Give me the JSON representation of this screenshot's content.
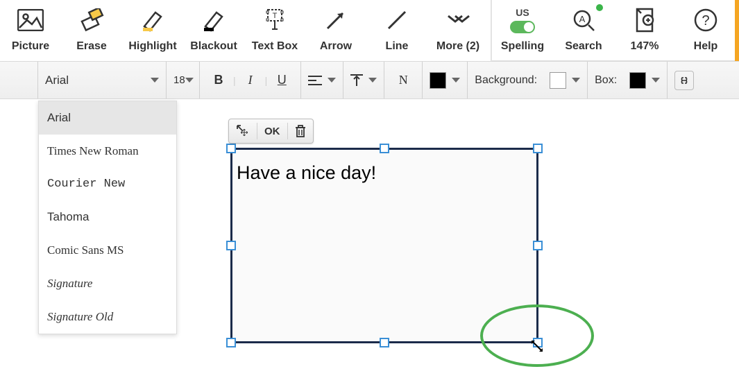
{
  "toolbar": {
    "picture": "Picture",
    "erase": "Erase",
    "highlight": "Highlight",
    "blackout": "Blackout",
    "textbox": "Text Box",
    "arrow": "Arrow",
    "line": "Line",
    "more": "More (2)",
    "spelling_lang": "US",
    "spelling": "Spelling",
    "search": "Search",
    "zoom": "147%",
    "help": "Help"
  },
  "format": {
    "font": "Arial",
    "size": "18",
    "bold": "B",
    "italic": "I",
    "underline": "U",
    "normal": "N",
    "background_label": "Background:",
    "box_label": "Box:",
    "text_color": "#000000",
    "background_color": "#ffffff",
    "box_color": "#000000"
  },
  "font_options": [
    "Arial",
    "Times New Roman",
    "Courier New",
    "Tahoma",
    "Comic Sans MS",
    "Signature",
    "Signature Old"
  ],
  "float_bar": {
    "ok": "OK"
  },
  "textbox_content": "Have a nice day!"
}
